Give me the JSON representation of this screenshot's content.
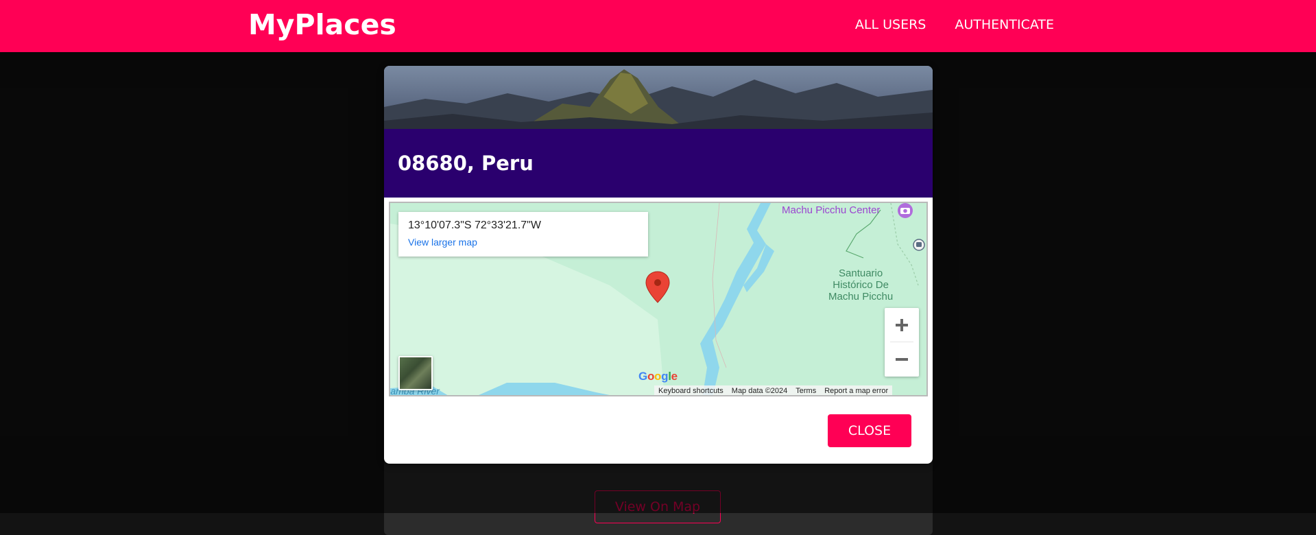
{
  "app": {
    "brand": "MyPlaces",
    "nav": [
      {
        "label": "ALL USERS"
      },
      {
        "label": "AUTHENTICATE"
      }
    ],
    "accent_color": "#ff0055"
  },
  "modal": {
    "title": "08680, Peru",
    "header_color": "#2a006e",
    "close_label": "CLOSE"
  },
  "map": {
    "coordinates": "13°10'07.3\"S 72°33'21.7\"W",
    "larger_map_link": "View larger map",
    "poi": {
      "center": "Machu Picchu Center",
      "sanctuary_line1": "Santuario",
      "sanctuary_line2": "Histórico De",
      "sanctuary_line3": "Machu Picchu",
      "river": "Urubamba River"
    },
    "logo": "Google",
    "attribution": [
      "Keyboard shortcuts",
      "Map data ©2024",
      "Terms",
      "Report a map error"
    ],
    "zoom_in": "+",
    "zoom_out": "−"
  },
  "background_card": {
    "button_label": "View On Map"
  }
}
